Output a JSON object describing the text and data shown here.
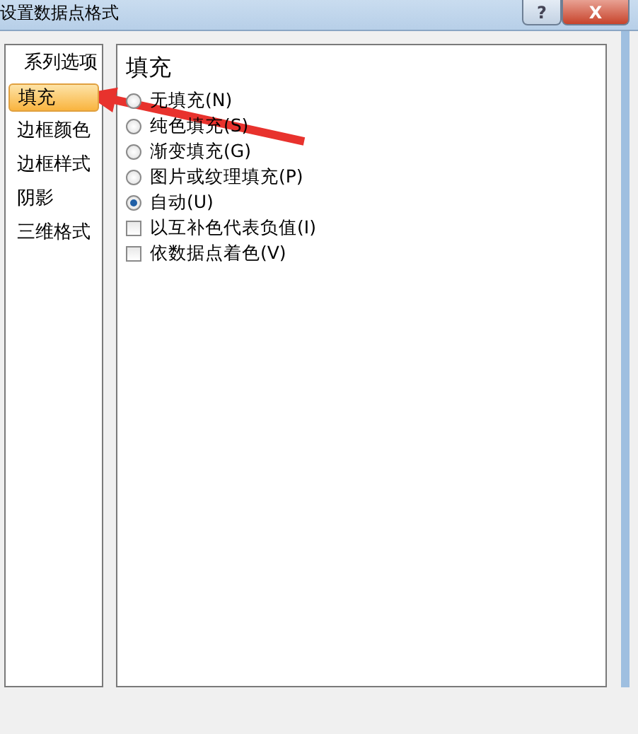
{
  "window": {
    "title": "设置数据点格式",
    "buttons": [
      {
        "kind": "help",
        "label": "?"
      },
      {
        "kind": "close",
        "label": "X"
      }
    ]
  },
  "sidebar": {
    "items": [
      {
        "label": "系列选项",
        "selected": false
      },
      {
        "label": "填充",
        "selected": true
      },
      {
        "label": "边框颜色",
        "selected": false
      },
      {
        "label": "边框样式",
        "selected": false
      },
      {
        "label": "阴影",
        "selected": false
      },
      {
        "label": "三维格式",
        "selected": false
      }
    ]
  },
  "panel": {
    "heading": "填充",
    "options": [
      {
        "kind": "radio",
        "label": "无填充(N)",
        "checked": false
      },
      {
        "kind": "radio",
        "label": "纯色填充(S)",
        "checked": false
      },
      {
        "kind": "radio",
        "label": "渐变填充(G)",
        "checked": false
      },
      {
        "kind": "radio",
        "label": "图片或纹理填充(P)",
        "checked": false
      },
      {
        "kind": "radio",
        "label": "自动(U)",
        "checked": true
      },
      {
        "kind": "checkbox",
        "label": "以互补色代表负值(I)",
        "checked": false
      },
      {
        "kind": "checkbox",
        "label": "依数据点着色(V)",
        "checked": false
      }
    ]
  }
}
